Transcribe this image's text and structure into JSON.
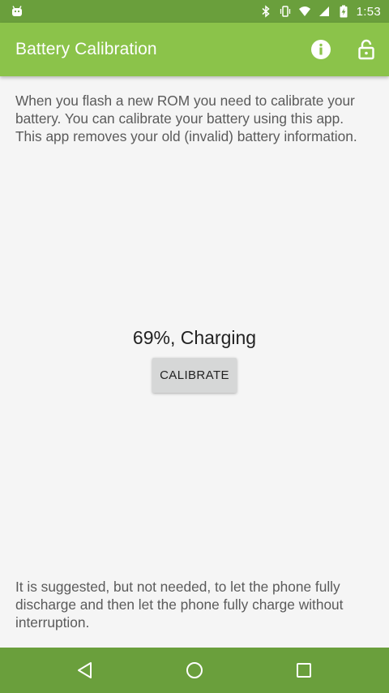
{
  "status_bar": {
    "time": "1:53",
    "icons": [
      "android-notification-icon",
      "bluetooth-icon",
      "vibrate-icon",
      "wifi-icon",
      "signal-icon",
      "battery-charging-icon"
    ]
  },
  "app_bar": {
    "title": "Battery Calibration",
    "actions": [
      "info-icon",
      "unlock-icon"
    ]
  },
  "main": {
    "intro": "When you flash a new ROM you need to calibrate your battery. You can calibrate your battery using this app. This app removes your old (invalid) battery information.",
    "battery_status": "69%, Charging",
    "calibrate_label": "CALIBRATE",
    "footer": "It is suggested, but not needed, to let the phone fully discharge and then let the phone fully charge without interruption."
  },
  "nav_bar": {
    "buttons": [
      "back-icon",
      "home-icon",
      "recents-icon"
    ]
  },
  "colors": {
    "status_bar": "#6a9f3c",
    "app_bar": "#8bc34a",
    "nav_bar": "#6a9f3c",
    "background": "#f5f5f5",
    "button": "#d6d7d7"
  }
}
